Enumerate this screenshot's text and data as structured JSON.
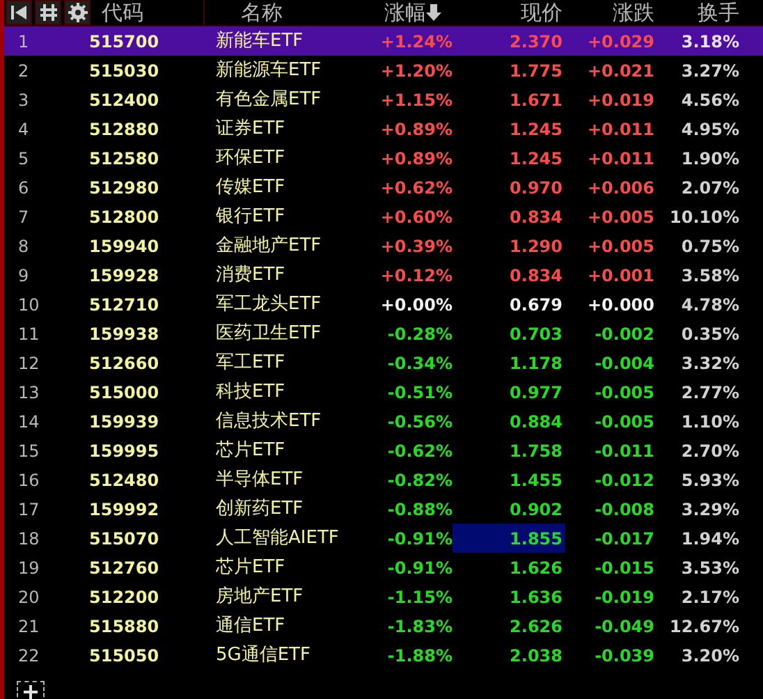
{
  "toolbar": {
    "buttons": [
      {
        "kind": "first"
      },
      {
        "kind": "sort"
      },
      {
        "kind": "settings"
      }
    ]
  },
  "columns": [
    {
      "label": "代码",
      "sorted": false
    },
    {
      "label": "名称",
      "sorted": false
    },
    {
      "label": "涨幅",
      "sorted": true
    },
    {
      "label": "现价",
      "sorted": false
    },
    {
      "label": "涨跌",
      "sorted": false
    },
    {
      "label": "换手",
      "sorted": false
    }
  ],
  "rows": [
    {
      "index": "1",
      "code": "515700",
      "name": "新能车ETF",
      "change_pct": "+1.24%",
      "price": "2.370",
      "change": "+0.029",
      "turnover": "3.18%",
      "kind": "up",
      "selected": true,
      "price_focused": false
    },
    {
      "index": "2",
      "code": "515030",
      "name": "新能源车ETF",
      "change_pct": "+1.20%",
      "price": "1.775",
      "change": "+0.021",
      "turnover": "3.27%",
      "kind": "up",
      "selected": false,
      "price_focused": false
    },
    {
      "index": "3",
      "code": "512400",
      "name": "有色金属ETF",
      "change_pct": "+1.15%",
      "price": "1.671",
      "change": "+0.019",
      "turnover": "4.56%",
      "kind": "up",
      "selected": false,
      "price_focused": false
    },
    {
      "index": "4",
      "code": "512880",
      "name": "证券ETF",
      "change_pct": "+0.89%",
      "price": "1.245",
      "change": "+0.011",
      "turnover": "4.95%",
      "kind": "up",
      "selected": false,
      "price_focused": false
    },
    {
      "index": "5",
      "code": "512580",
      "name": "环保ETF",
      "change_pct": "+0.89%",
      "price": "1.245",
      "change": "+0.011",
      "turnover": "1.90%",
      "kind": "up",
      "selected": false,
      "price_focused": false
    },
    {
      "index": "6",
      "code": "512980",
      "name": "传媒ETF",
      "change_pct": "+0.62%",
      "price": "0.970",
      "change": "+0.006",
      "turnover": "2.07%",
      "kind": "up",
      "selected": false,
      "price_focused": false
    },
    {
      "index": "7",
      "code": "512800",
      "name": "银行ETF",
      "change_pct": "+0.60%",
      "price": "0.834",
      "change": "+0.005",
      "turnover": "10.10%",
      "kind": "up",
      "selected": false,
      "price_focused": false
    },
    {
      "index": "8",
      "code": "159940",
      "name": "金融地产ETF",
      "change_pct": "+0.39%",
      "price": "1.290",
      "change": "+0.005",
      "turnover": "0.75%",
      "kind": "up",
      "selected": false,
      "price_focused": false
    },
    {
      "index": "9",
      "code": "159928",
      "name": "消费ETF",
      "change_pct": "+0.12%",
      "price": "0.834",
      "change": "+0.001",
      "turnover": "3.58%",
      "kind": "up",
      "selected": false,
      "price_focused": false
    },
    {
      "index": "10",
      "code": "512710",
      "name": "军工龙头ETF",
      "change_pct": "+0.00%",
      "price": "0.679",
      "change": "+0.000",
      "turnover": "4.78%",
      "kind": "flat",
      "selected": false,
      "price_focused": false
    },
    {
      "index": "11",
      "code": "159938",
      "name": "医药卫生ETF",
      "change_pct": "-0.28%",
      "price": "0.703",
      "change": "-0.002",
      "turnover": "0.35%",
      "kind": "down",
      "selected": false,
      "price_focused": false
    },
    {
      "index": "12",
      "code": "512660",
      "name": "军工ETF",
      "change_pct": "-0.34%",
      "price": "1.178",
      "change": "-0.004",
      "turnover": "3.32%",
      "kind": "down",
      "selected": false,
      "price_focused": false
    },
    {
      "index": "13",
      "code": "515000",
      "name": "科技ETF",
      "change_pct": "-0.51%",
      "price": "0.977",
      "change": "-0.005",
      "turnover": "2.77%",
      "kind": "down",
      "selected": false,
      "price_focused": false
    },
    {
      "index": "14",
      "code": "159939",
      "name": "信息技术ETF",
      "change_pct": "-0.56%",
      "price": "0.884",
      "change": "-0.005",
      "turnover": "1.10%",
      "kind": "down",
      "selected": false,
      "price_focused": false
    },
    {
      "index": "15",
      "code": "159995",
      "name": "芯片ETF",
      "change_pct": "-0.62%",
      "price": "1.758",
      "change": "-0.011",
      "turnover": "2.70%",
      "kind": "down",
      "selected": false,
      "price_focused": false
    },
    {
      "index": "16",
      "code": "512480",
      "name": "半导体ETF",
      "change_pct": "-0.82%",
      "price": "1.455",
      "change": "-0.012",
      "turnover": "5.93%",
      "kind": "down",
      "selected": false,
      "price_focused": false
    },
    {
      "index": "17",
      "code": "159992",
      "name": "创新药ETF",
      "change_pct": "-0.88%",
      "price": "0.902",
      "change": "-0.008",
      "turnover": "3.29%",
      "kind": "down",
      "selected": false,
      "price_focused": false
    },
    {
      "index": "18",
      "code": "515070",
      "name": "人工智能AIETF",
      "change_pct": "-0.91%",
      "price": "1.855",
      "change": "-0.017",
      "turnover": "1.94%",
      "kind": "down",
      "selected": false,
      "price_focused": true
    },
    {
      "index": "19",
      "code": "512760",
      "name": "芯片ETF",
      "change_pct": "-0.91%",
      "price": "1.626",
      "change": "-0.015",
      "turnover": "3.53%",
      "kind": "down",
      "selected": false,
      "price_focused": false
    },
    {
      "index": "20",
      "code": "512200",
      "name": "房地产ETF",
      "change_pct": "-1.15%",
      "price": "1.636",
      "change": "-0.019",
      "turnover": "2.17%",
      "kind": "down",
      "selected": false,
      "price_focused": false
    },
    {
      "index": "21",
      "code": "515880",
      "name": "通信ETF",
      "change_pct": "-1.83%",
      "price": "2.626",
      "change": "-0.049",
      "turnover": "12.67%",
      "kind": "down",
      "selected": false,
      "price_focused": false
    },
    {
      "index": "22",
      "code": "515050",
      "name": "5G通信ETF",
      "change_pct": "-1.88%",
      "price": "2.038",
      "change": "-0.039",
      "turnover": "3.20%",
      "kind": "down",
      "selected": false,
      "price_focused": false
    }
  ],
  "add_button": {
    "kind": "add"
  }
}
